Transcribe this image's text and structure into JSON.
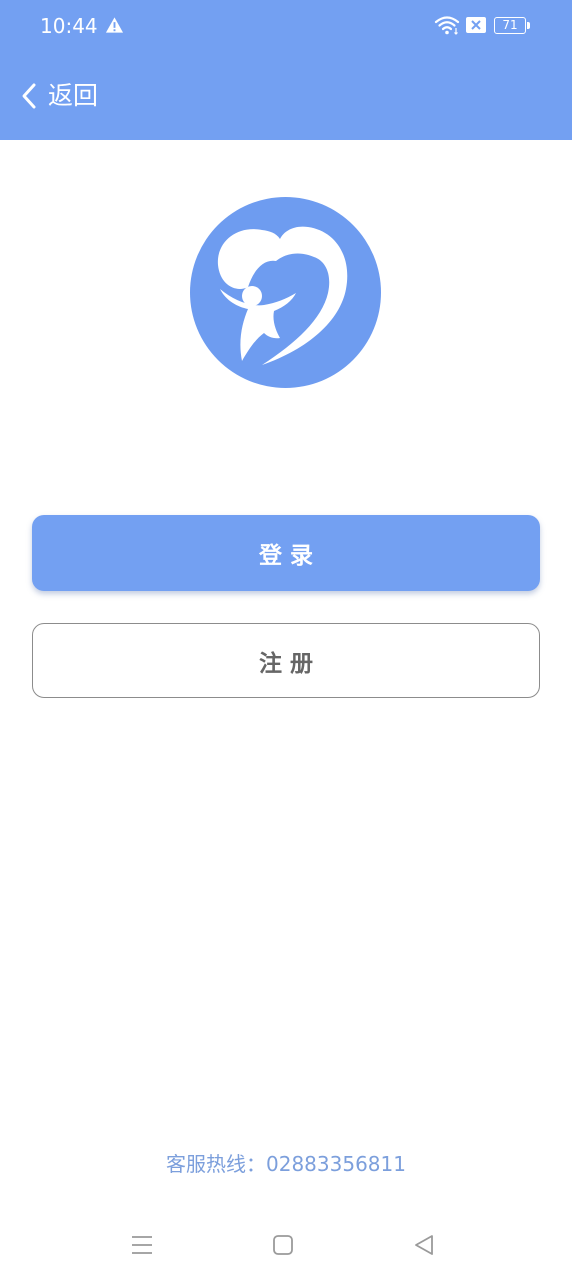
{
  "status_bar": {
    "time": "10:44",
    "battery_level": "71"
  },
  "header": {
    "back_label": "返回",
    "background_color": "#73a0f2"
  },
  "logo": {
    "icon": "heart-child-logo-icon",
    "color": "#6e9cf0"
  },
  "actions": {
    "login_label": "登录",
    "register_label": "注册",
    "accent_color": "#73a0f2"
  },
  "footer": {
    "hotline_text": "客服热线：02883356811"
  },
  "nav_bar": {
    "icons": [
      "menu-icon",
      "home-square-icon",
      "back-triangle-icon"
    ]
  }
}
